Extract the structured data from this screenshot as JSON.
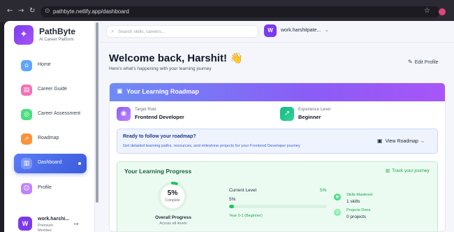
{
  "browser": {
    "url": "pathbyte.netlify.app/dashboard",
    "back_icon": "←",
    "forward_icon": "→",
    "reload_icon": "↻",
    "lock_icon": "⊙",
    "star_icon": "☆"
  },
  "brand": {
    "name": "PathByte",
    "subtitle": "AI Career Platform",
    "logo_icon": "✦"
  },
  "sidebar": {
    "items": [
      {
        "label": "Home",
        "icon": "⌂",
        "color": "#60a5fa",
        "active": false
      },
      {
        "label": "Career Guide",
        "icon": "▤",
        "color": "#f472b6",
        "active": false
      },
      {
        "label": "Career Assessment",
        "icon": "◎",
        "color": "#4ade80",
        "active": false
      },
      {
        "label": "Roadmap",
        "icon": "➚",
        "color": "#fb923c",
        "active": false
      },
      {
        "label": "Dashboard",
        "icon": "▥",
        "color": "#3b5bdb",
        "active": true
      },
      {
        "label": "Profile",
        "icon": "☺",
        "color": "#c084fc",
        "active": false
      }
    ]
  },
  "user_card": {
    "avatar": "W",
    "name": "work.harshi...",
    "tier": "Premium Member",
    "logout_icon": "↦"
  },
  "header": {
    "search_placeholder": "Search skills, careers...",
    "search_icon": "⌕",
    "avatar": "W",
    "username": "work.harshitpate...",
    "chevron": "⌄"
  },
  "welcome": {
    "title": "Welcome back, Harshit! 👋",
    "subtitle": "Here's what's happening with your learning journey",
    "edit_icon": "✎",
    "edit_label": "Edit Profile"
  },
  "roadmap": {
    "title": "Your Learning Roadmap",
    "title_icon": "▣",
    "target_role_label": "Target Role",
    "target_role_value": "Frontend Developer",
    "target_icon": "◉",
    "experience_label": "Experience Level",
    "experience_value": "Beginner",
    "experience_icon": "↗",
    "ready_title": "Ready to follow your roadmap?",
    "ready_subtitle": "Get detailed learning paths, resources, and milestone projects for your Frontend Developer journey",
    "view_icon": "▣",
    "view_label": "View Roadmap →"
  },
  "progress": {
    "title": "Your Learning Progress",
    "track_icon": "▥",
    "track_label": "Track your journey",
    "overall_value": 0.05,
    "overall_pct": "5%",
    "overall_caption": "Complete",
    "overall_label": "Overall Progress",
    "overall_sub": "Across all levels",
    "current_level_label": "Current Level",
    "current_level_pct": "5%",
    "current_level_value": "5%",
    "current_level_fill": 0.05,
    "level_range": "Year 0-1 (Beginner)",
    "skills_label": "Skills Mastered",
    "skills_value": "1 skills",
    "skills_icon": "◉",
    "projects_label": "Projects Done",
    "projects_value": "0 projects",
    "projects_icon": "◎"
  },
  "colors": {
    "accent": "#3b5bdb",
    "purple": "#8b5cf6",
    "green": "#22c55e"
  }
}
